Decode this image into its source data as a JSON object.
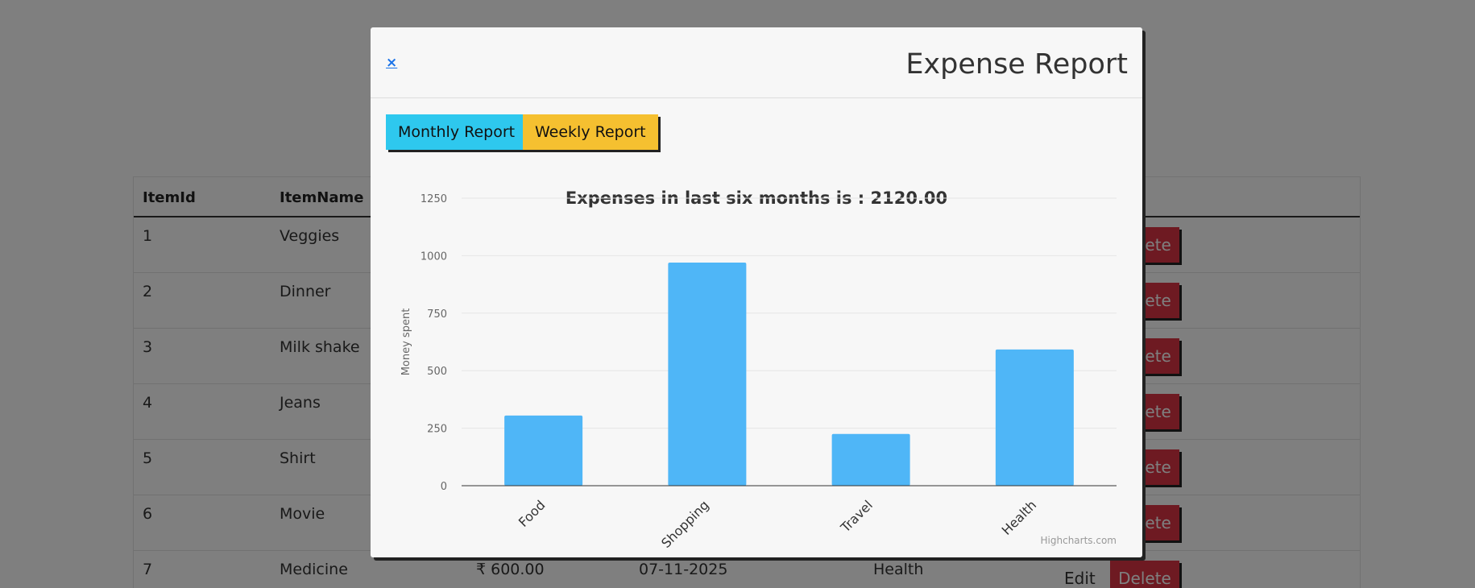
{
  "table": {
    "headers": [
      "ItemId",
      "ItemName"
    ],
    "rows": [
      {
        "id": "1",
        "name": "Veggies"
      },
      {
        "id": "2",
        "name": "Dinner"
      },
      {
        "id": "3",
        "name": "Milk shake"
      },
      {
        "id": "4",
        "name": "Jeans"
      },
      {
        "id": "5",
        "name": "Shirt"
      },
      {
        "id": "6",
        "name": "Movie"
      },
      {
        "id": "7",
        "name": "Medicine",
        "amount": "₹ 600.00",
        "date": "07-11-2025",
        "category": "Health"
      }
    ],
    "edit_label": "Edit",
    "delete_label": "Delete",
    "delete_partial": "ete"
  },
  "modal": {
    "close_label": "×",
    "title": "Expense Report",
    "monthly_button": "Monthly Report",
    "weekly_button": "Weekly Report",
    "credit": "Highcharts.com"
  },
  "colors": {
    "bar": "#4fb6f7",
    "monthly": "#2ec8ee",
    "weekly": "#f5c030",
    "delete": "#dc3545"
  },
  "chart_data": {
    "type": "bar",
    "title": "Expenses in last six months is : 2120.00",
    "xlabel": "",
    "ylabel": "Money spent",
    "categories": [
      "Food",
      "Shopping",
      "Travel",
      "Health"
    ],
    "values": [
      305,
      970,
      225,
      592
    ],
    "ylim": [
      0,
      1250
    ],
    "yticks": [
      "0",
      "250",
      "500",
      "750",
      "1000",
      "1250"
    ],
    "grid": true,
    "legend": "none"
  }
}
